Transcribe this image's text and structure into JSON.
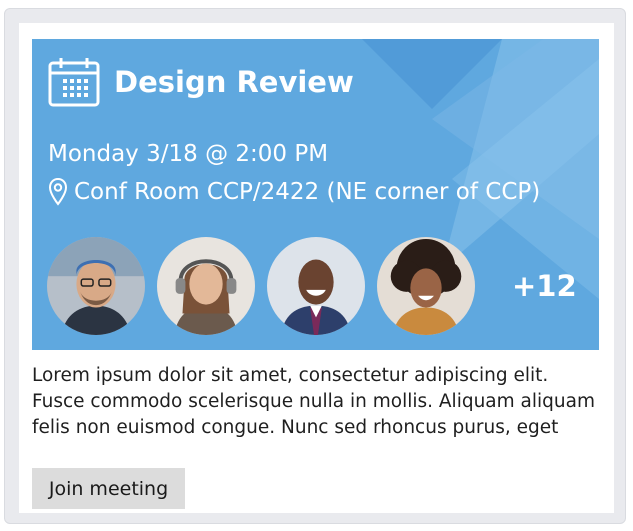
{
  "event": {
    "title": "Design Review",
    "when": "Monday 3/18 @ 2:00 PM",
    "location": "Conf Room CCP/2422 (NE corner of CCP)",
    "more_attendees": "+12"
  },
  "description": "Lorem ipsum dolor sit amet, consectetur adipiscing elit. Fusce commodo scelerisque nulla in mollis. Aliquam aliquam felis non euismod congue. Nunc sed rhoncus purus, eget",
  "actions": {
    "join_label": "Join meeting"
  },
  "icons": {
    "calendar": "calendar-icon",
    "location": "location-pin-icon"
  },
  "colors": {
    "hero": "#5fa8df",
    "button": "#dcdcdc"
  }
}
